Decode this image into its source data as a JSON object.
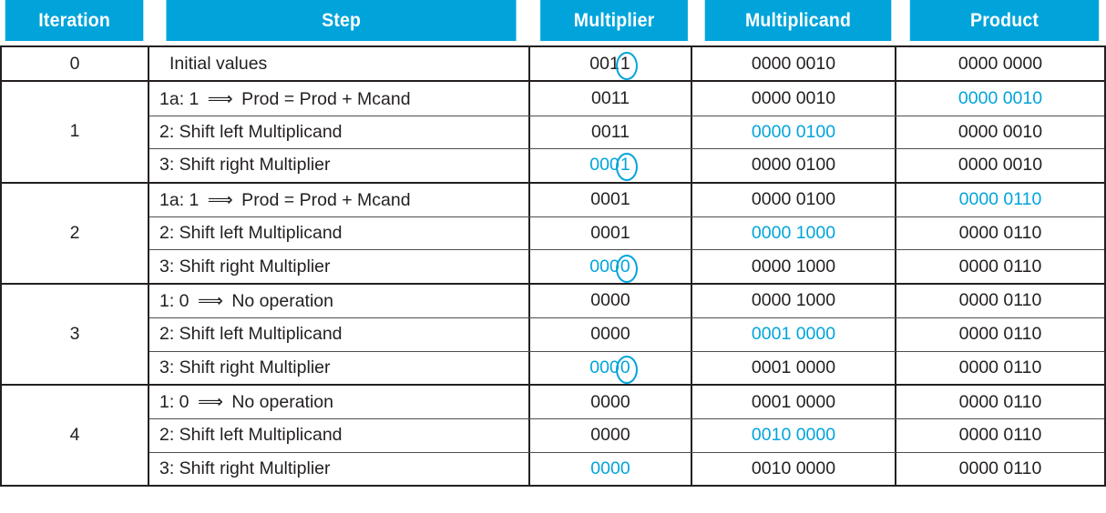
{
  "colors": {
    "accent": "#00a4db",
    "text": "#231f20",
    "header_text": "#ffffff",
    "background": "#ffffff"
  },
  "table": {
    "headers": {
      "iteration": "Iteration",
      "step": "Step",
      "multiplier": "Multiplier",
      "multiplicand": "Multiplicand",
      "product": "Product"
    },
    "initial_row": {
      "iteration": "0",
      "step": "Initial values",
      "multiplier": {
        "prefix": "001",
        "last": "1",
        "circled": true,
        "highlight": false
      },
      "multiplicand": {
        "text": "0000 0010",
        "highlight": false
      },
      "product": {
        "text": "0000 0000",
        "highlight": false
      }
    },
    "iterations": [
      {
        "iteration": "1",
        "rows": [
          {
            "step_num": "1a:",
            "step_bit": "1",
            "step_arrow": "⟹",
            "step_text": "Prod = Prod + Mcand",
            "multiplier": {
              "prefix": "0011",
              "last": "",
              "circled": false,
              "highlight": false
            },
            "multiplicand": {
              "text": "0000 0010",
              "highlight": false
            },
            "product": {
              "text": "0000 0010",
              "highlight": true
            }
          },
          {
            "step_num": "2:",
            "step_bit": "",
            "step_arrow": "",
            "step_text": "Shift left Multiplicand",
            "multiplier": {
              "prefix": "0011",
              "last": "",
              "circled": false,
              "highlight": false
            },
            "multiplicand": {
              "text": "0000 0100",
              "highlight": true
            },
            "product": {
              "text": "0000 0010",
              "highlight": false
            }
          },
          {
            "step_num": "3:",
            "step_bit": "",
            "step_arrow": "",
            "step_text": "Shift right Multiplier",
            "multiplier": {
              "prefix": "000",
              "last": "1",
              "circled": true,
              "highlight": true
            },
            "multiplicand": {
              "text": "0000 0100",
              "highlight": false
            },
            "product": {
              "text": "0000 0010",
              "highlight": false
            }
          }
        ]
      },
      {
        "iteration": "2",
        "rows": [
          {
            "step_num": "1a:",
            "step_bit": "1",
            "step_arrow": "⟹",
            "step_text": "Prod = Prod + Mcand",
            "multiplier": {
              "prefix": "0001",
              "last": "",
              "circled": false,
              "highlight": false
            },
            "multiplicand": {
              "text": "0000 0100",
              "highlight": false
            },
            "product": {
              "text": "0000 0110",
              "highlight": true
            }
          },
          {
            "step_num": "2:",
            "step_bit": "",
            "step_arrow": "",
            "step_text": "Shift left Multiplicand",
            "multiplier": {
              "prefix": "0001",
              "last": "",
              "circled": false,
              "highlight": false
            },
            "multiplicand": {
              "text": "0000 1000",
              "highlight": true
            },
            "product": {
              "text": "0000 0110",
              "highlight": false
            }
          },
          {
            "step_num": "3:",
            "step_bit": "",
            "step_arrow": "",
            "step_text": "Shift right Multiplier",
            "multiplier": {
              "prefix": "000",
              "last": "0",
              "circled": true,
              "highlight": true
            },
            "multiplicand": {
              "text": "0000 1000",
              "highlight": false
            },
            "product": {
              "text": "0000 0110",
              "highlight": false
            }
          }
        ]
      },
      {
        "iteration": "3",
        "rows": [
          {
            "step_num": "1:",
            "step_bit": "0",
            "step_arrow": "⟹",
            "step_text": "No operation",
            "multiplier": {
              "prefix": "0000",
              "last": "",
              "circled": false,
              "highlight": false
            },
            "multiplicand": {
              "text": "0000 1000",
              "highlight": false
            },
            "product": {
              "text": "0000 0110",
              "highlight": false
            }
          },
          {
            "step_num": "2:",
            "step_bit": "",
            "step_arrow": "",
            "step_text": "Shift left Multiplicand",
            "multiplier": {
              "prefix": "0000",
              "last": "",
              "circled": false,
              "highlight": false
            },
            "multiplicand": {
              "text": "0001 0000",
              "highlight": true
            },
            "product": {
              "text": "0000 0110",
              "highlight": false
            }
          },
          {
            "step_num": "3:",
            "step_bit": "",
            "step_arrow": "",
            "step_text": "Shift right Multiplier",
            "multiplier": {
              "prefix": "000",
              "last": "0",
              "circled": true,
              "highlight": true
            },
            "multiplicand": {
              "text": "0001 0000",
              "highlight": false
            },
            "product": {
              "text": "0000 0110",
              "highlight": false
            }
          }
        ]
      },
      {
        "iteration": "4",
        "rows": [
          {
            "step_num": "1:",
            "step_bit": "0",
            "step_arrow": "⟹",
            "step_text": "No operation",
            "multiplier": {
              "prefix": "0000",
              "last": "",
              "circled": false,
              "highlight": false
            },
            "multiplicand": {
              "text": "0001 0000",
              "highlight": false
            },
            "product": {
              "text": "0000 0110",
              "highlight": false
            }
          },
          {
            "step_num": "2:",
            "step_bit": "",
            "step_arrow": "",
            "step_text": "Shift left Multiplicand",
            "multiplier": {
              "prefix": "0000",
              "last": "",
              "circled": false,
              "highlight": false
            },
            "multiplicand": {
              "text": "0010 0000",
              "highlight": true
            },
            "product": {
              "text": "0000 0110",
              "highlight": false
            }
          },
          {
            "step_num": "3:",
            "step_bit": "",
            "step_arrow": "",
            "step_text": "Shift right Multiplier",
            "multiplier": {
              "prefix": "0000",
              "last": "",
              "circled": false,
              "highlight": true
            },
            "multiplicand": {
              "text": "0010 0000",
              "highlight": false
            },
            "product": {
              "text": "0000 0110",
              "highlight": false
            }
          }
        ]
      }
    ]
  }
}
